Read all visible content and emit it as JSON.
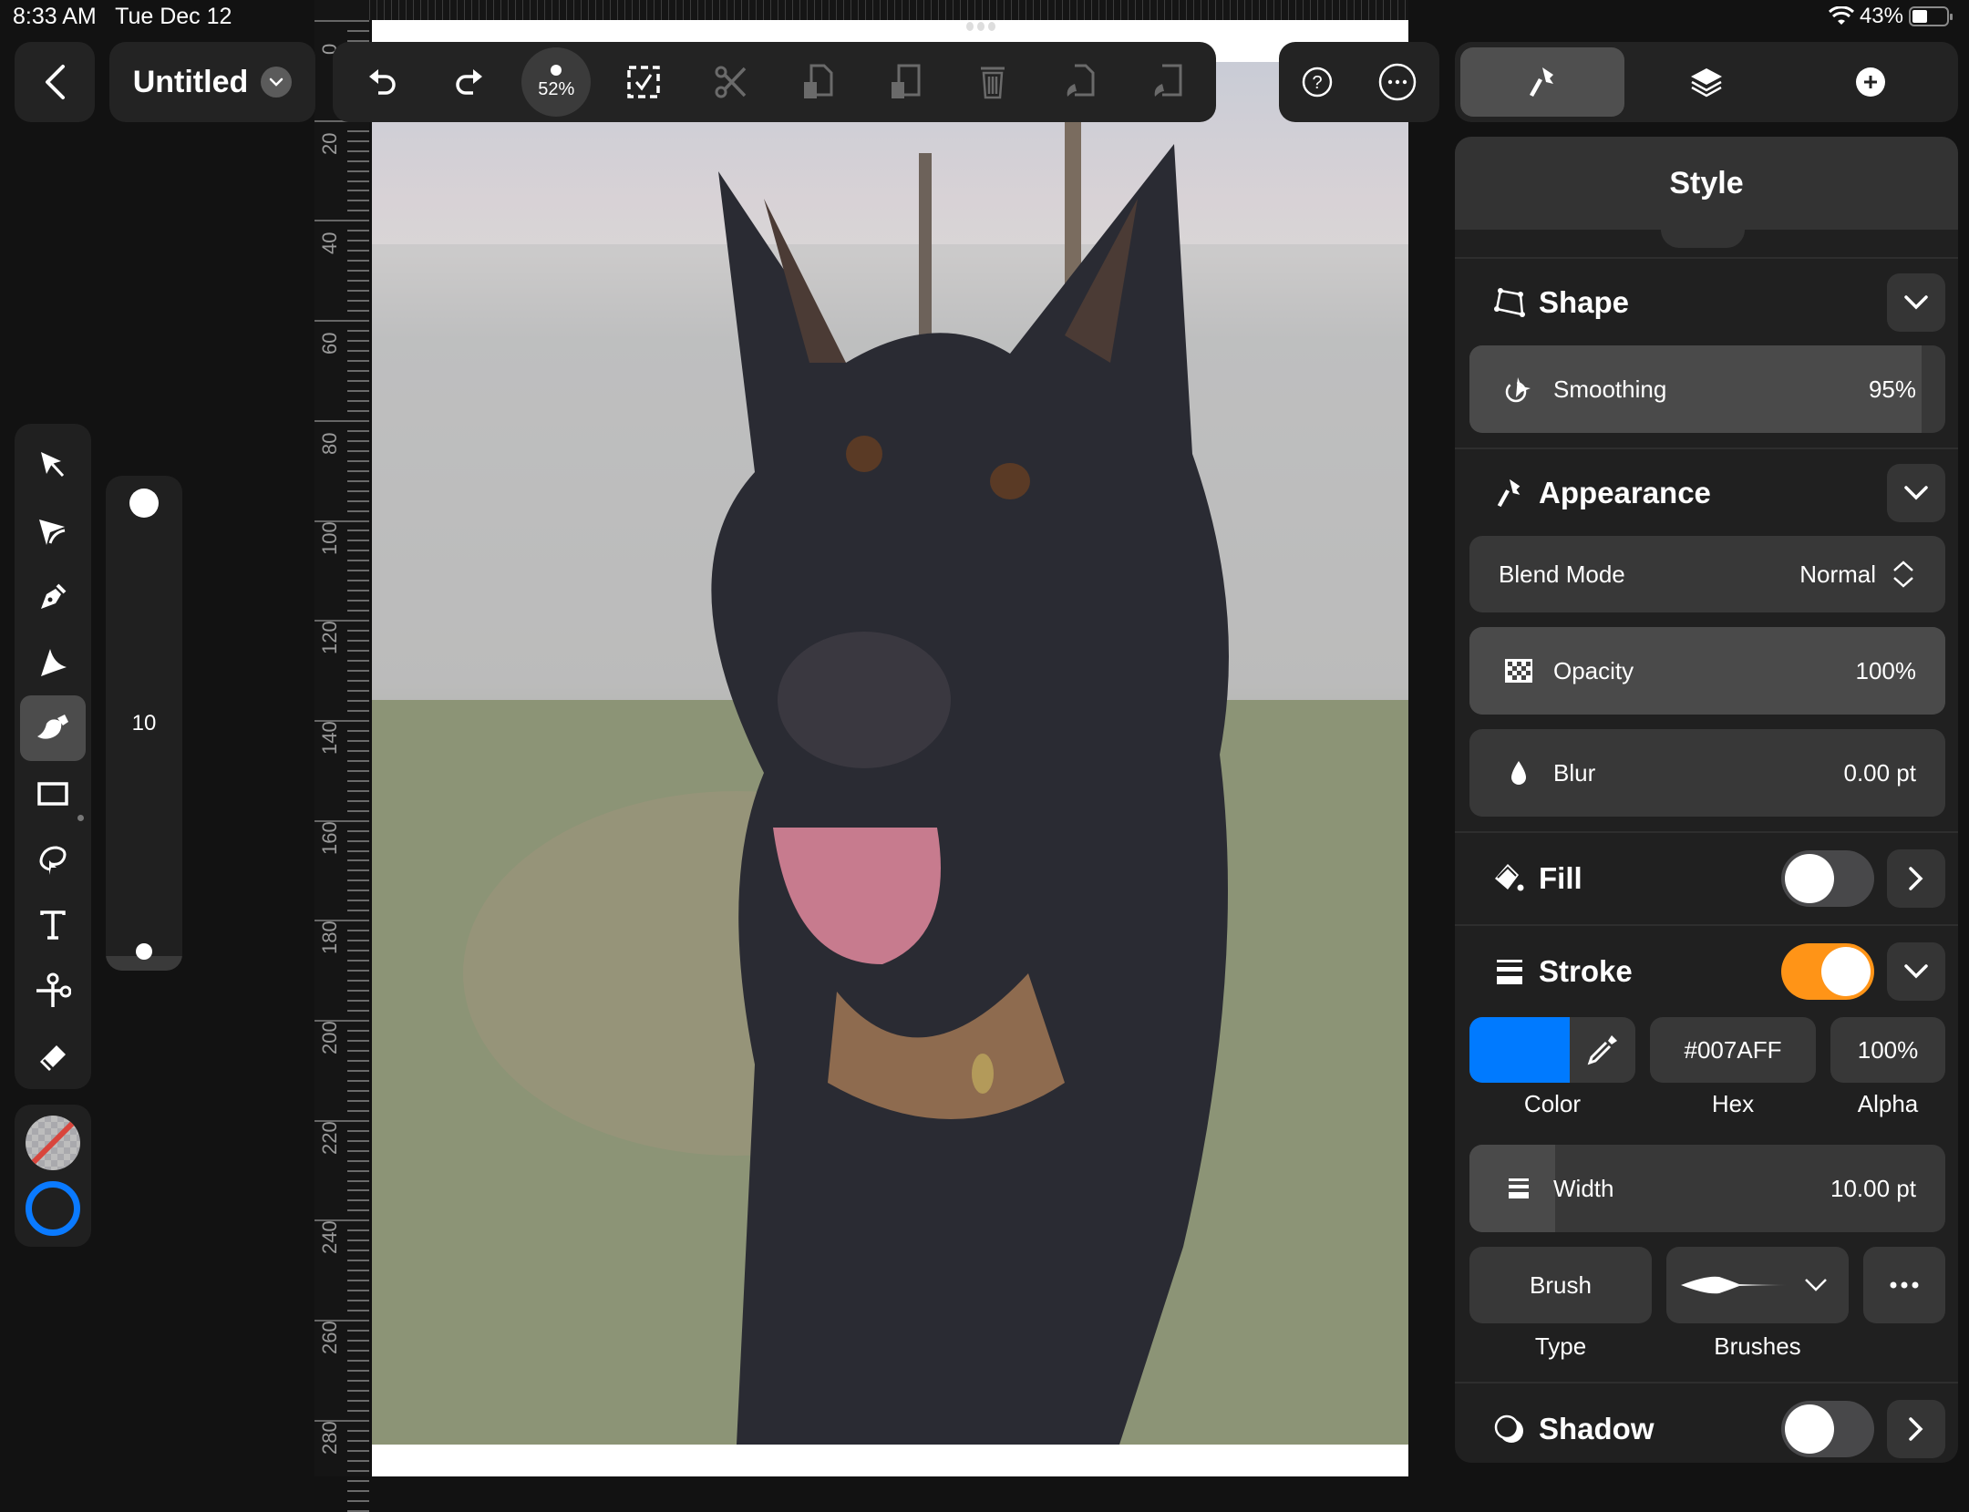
{
  "status_bar": {
    "time": "8:33 AM",
    "date": "Tue Dec 12",
    "battery": "43%"
  },
  "document": {
    "title": "Untitled"
  },
  "toolbar": {
    "zoom": "52%",
    "buttons": [
      "undo-icon",
      "redo-icon",
      "zoom-level",
      "select-all-icon",
      "cut-icon",
      "copy-icon",
      "paste-icon",
      "delete-icon",
      "copy-style-icon",
      "paste-style-icon"
    ]
  },
  "ruler": {
    "labels": [
      "0",
      "20",
      "40",
      "60",
      "80",
      "100",
      "120",
      "140",
      "160",
      "180",
      "200",
      "220",
      "240",
      "260",
      "280"
    ]
  },
  "tabs": [
    {
      "name": "style",
      "icon": "brush-icon",
      "active": true
    },
    {
      "name": "layers",
      "icon": "layers-icon",
      "active": false
    },
    {
      "name": "add",
      "icon": "plus-circle-icon",
      "active": false
    }
  ],
  "tools": [
    {
      "name": "selection",
      "active": false
    },
    {
      "name": "direct-selection",
      "active": false
    },
    {
      "name": "pen",
      "active": false
    },
    {
      "name": "vector-brush",
      "active": false
    },
    {
      "name": "brush",
      "active": true
    },
    {
      "name": "shape-rectangle",
      "active": false
    },
    {
      "name": "lasso",
      "active": false
    },
    {
      "name": "text",
      "active": false
    },
    {
      "name": "scissors",
      "active": false
    },
    {
      "name": "eraser",
      "active": false
    }
  ],
  "size_slider": {
    "value": "10"
  },
  "panel": {
    "title": "Style",
    "shape": {
      "title": "Shape",
      "smoothing_label": "Smoothing",
      "smoothing_value": "95%",
      "smoothing_fraction": 0.95
    },
    "appearance": {
      "title": "Appearance",
      "blend_label": "Blend Mode",
      "blend_value": "Normal",
      "opacity_label": "Opacity",
      "opacity_value": "100%",
      "blur_label": "Blur",
      "blur_value": "0.00 pt"
    },
    "fill": {
      "title": "Fill",
      "enabled": false
    },
    "stroke": {
      "title": "Stroke",
      "enabled": true,
      "color": "#007AFF",
      "hex_value": "#007AFF",
      "alpha_value": "100%",
      "color_caption": "Color",
      "hex_caption": "Hex",
      "alpha_caption": "Alpha",
      "width_label": "Width",
      "width_value": "10.00 pt",
      "type_value": "Brush",
      "type_caption": "Type",
      "brushes_caption": "Brushes"
    },
    "shadow": {
      "title": "Shadow",
      "enabled": false
    }
  },
  "colors": {
    "accent_orange": "#FF9417",
    "stroke_blue": "#0A7AFF"
  }
}
